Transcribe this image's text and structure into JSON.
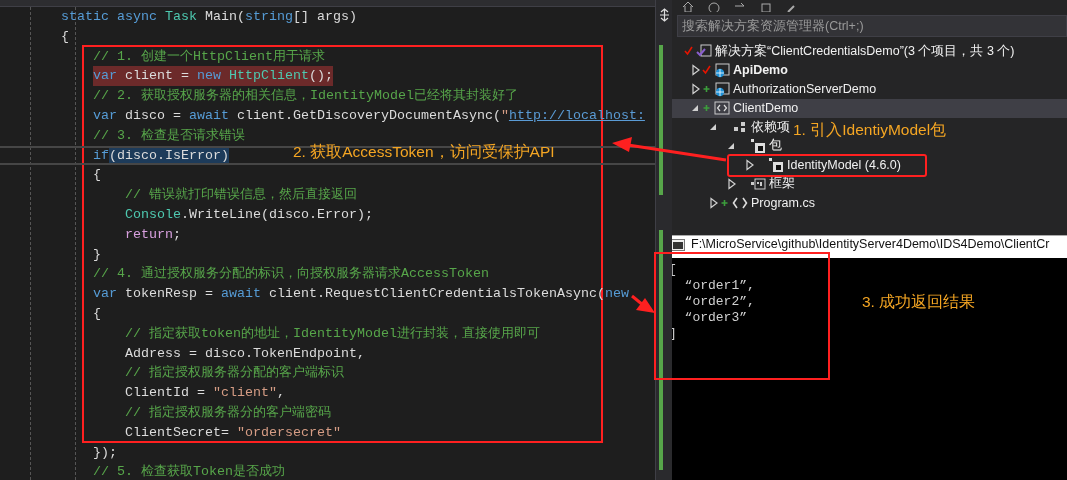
{
  "editor": {
    "lines": [
      {
        "breakpoint": false,
        "current": false,
        "tokens": [
          {
            "kind": "keyword",
            "text": "static"
          },
          {
            "kind": "keyword",
            "text": " async"
          },
          {
            "kind": "type",
            "text": " Task"
          },
          {
            "kind": "plain",
            "text": " Main("
          },
          {
            "kind": "keyword",
            "text": "string"
          },
          {
            "kind": "plain",
            "text": "[] args)"
          }
        ]
      },
      {
        "breakpoint": false,
        "current": false,
        "tokens": [
          {
            "kind": "plain",
            "text": "{"
          }
        ]
      },
      {
        "breakpoint": false,
        "current": false,
        "tokens": [
          {
            "kind": "comment",
            "text": "    // 1. 创建一个HttpClient用于请求"
          }
        ]
      },
      {
        "breakpoint": true,
        "current": false,
        "tokens": [
          {
            "kind": "keyword",
            "text": "    var"
          },
          {
            "kind": "plain",
            "text": " client = "
          },
          {
            "kind": "keyword",
            "text": "new"
          },
          {
            "kind": "type",
            "text": " HttpClient"
          },
          {
            "kind": "plain",
            "text": "();"
          }
        ]
      },
      {
        "breakpoint": false,
        "current": false,
        "tokens": [
          {
            "kind": "comment",
            "text": "    // 2. 获取授权服务器的相关信息，IdentityModel已经将其封装好了"
          }
        ]
      },
      {
        "breakpoint": false,
        "current": false,
        "tokens": [
          {
            "kind": "keyword",
            "text": "    var"
          },
          {
            "kind": "plain",
            "text": " disco = "
          },
          {
            "kind": "keyword",
            "text": "await"
          },
          {
            "kind": "plain",
            "text": " client.GetDiscoveryDocumentAsync("
          },
          {
            "kind": "string",
            "text": "\""
          },
          {
            "kind": "link",
            "text": "http://localhost:"
          }
        ]
      },
      {
        "breakpoint": false,
        "current": false,
        "tokens": [
          {
            "kind": "comment",
            "text": "    // 3. 检查是否请求错误"
          }
        ]
      },
      {
        "breakpoint": false,
        "current": true,
        "tokens": [
          {
            "kind": "keyword",
            "text": "    if"
          },
          {
            "kind": "match",
            "text": "(disco.IsError)"
          }
        ]
      },
      {
        "breakpoint": false,
        "current": false,
        "tokens": [
          {
            "kind": "plain",
            "text": "    {"
          }
        ]
      },
      {
        "breakpoint": false,
        "current": false,
        "tokens": [
          {
            "kind": "comment",
            "text": "        // 错误就打印错误信息，然后直接返回"
          }
        ]
      },
      {
        "breakpoint": false,
        "current": false,
        "tokens": [
          {
            "kind": "type",
            "text": "        Console"
          },
          {
            "kind": "plain",
            "text": ".WriteLine(disco.Error);"
          }
        ]
      },
      {
        "breakpoint": false,
        "current": false,
        "tokens": [
          {
            "kind": "control",
            "text": "        return"
          },
          {
            "kind": "plain",
            "text": ";"
          }
        ]
      },
      {
        "breakpoint": false,
        "current": false,
        "tokens": [
          {
            "kind": "plain",
            "text": "    }"
          }
        ]
      },
      {
        "breakpoint": false,
        "current": false,
        "tokens": [
          {
            "kind": "comment",
            "text": "    // 4. 通过授权服务分配的标识，向授权服务器请求AccessToken"
          }
        ]
      },
      {
        "breakpoint": false,
        "current": false,
        "tokens": [
          {
            "kind": "keyword",
            "text": "    var"
          },
          {
            "kind": "plain",
            "text": " tokenResp = "
          },
          {
            "kind": "keyword",
            "text": "await"
          },
          {
            "kind": "plain",
            "text": " client.RequestClientCredentialsTokenAsync("
          },
          {
            "kind": "keyword",
            "text": "new"
          }
        ]
      },
      {
        "breakpoint": false,
        "current": false,
        "tokens": [
          {
            "kind": "plain",
            "text": "    {"
          }
        ]
      },
      {
        "breakpoint": false,
        "current": false,
        "tokens": [
          {
            "kind": "comment",
            "text": "        // 指定获取token的地址，IdentityModel进行封装，直接使用即可"
          }
        ]
      },
      {
        "breakpoint": false,
        "current": false,
        "tokens": [
          {
            "kind": "plain",
            "text": "        Address = disco.TokenEndpoint,"
          }
        ]
      },
      {
        "breakpoint": false,
        "current": false,
        "tokens": [
          {
            "kind": "comment",
            "text": "        // 指定授权服务器分配的客户端标识"
          }
        ]
      },
      {
        "breakpoint": false,
        "current": false,
        "tokens": [
          {
            "kind": "plain",
            "text": "        ClientId = "
          },
          {
            "kind": "string",
            "text": "\"client\""
          },
          {
            "kind": "plain",
            "text": ","
          }
        ]
      },
      {
        "breakpoint": false,
        "current": false,
        "tokens": [
          {
            "kind": "comment",
            "text": "        // 指定授权服务器分的客户端密码"
          }
        ]
      },
      {
        "breakpoint": false,
        "current": false,
        "tokens": [
          {
            "kind": "plain",
            "text": "        ClientSecret= "
          },
          {
            "kind": "string",
            "text": "\"ordersecret\""
          }
        ]
      },
      {
        "breakpoint": false,
        "current": false,
        "tokens": [
          {
            "kind": "plain",
            "text": "    });"
          }
        ]
      },
      {
        "breakpoint": false,
        "current": false,
        "tokens": [
          {
            "kind": "comment",
            "text": "    // 5. 检查获取Token是否成功"
          }
        ]
      }
    ]
  },
  "solution_explorer": {
    "search": {
      "placeholder": "搜索解决方案资源管理器(Ctrl+;)"
    },
    "solution": {
      "kind": "solution",
      "label": "解决方案“ClientCredentialsDemo”(3 个项目，共 3 个)",
      "checked_in": true,
      "children": [
        {
          "kind": "web",
          "label": "ApiDemo",
          "checked_in": true,
          "bold": true,
          "selected": false,
          "expanded": false
        },
        {
          "kind": "web",
          "label": "AuthorizationServerDemo",
          "checked_in": false,
          "added": true,
          "bold": false,
          "selected": false,
          "expanded": false
        },
        {
          "kind": "project",
          "label": "ClientDemo",
          "checked_in": false,
          "added": true,
          "bold": false,
          "selected": true,
          "expanded": true,
          "children": [
            {
              "kind": "dependencies",
              "label": "依赖项",
              "checked_in": false,
              "added": false,
              "bold": false,
              "selected": false,
              "expanded": true,
              "children": [
                {
                  "kind": "package",
                  "label": "包",
                  "checked_in": false,
                  "added": false,
                  "bold": false,
                  "selected": false,
                  "expanded": true,
                  "children": [
                    {
                      "kind": "package",
                      "label": "IdentityModel (4.6.0)",
                      "checked_in": false,
                      "added": false,
                      "bold": false,
                      "selected": false,
                      "expanded": false
                    }
                  ]
                },
                {
                  "kind": "framework",
                  "label": "框架",
                  "checked_in": false,
                  "added": false,
                  "bold": false,
                  "selected": false,
                  "expanded": false
                }
              ]
            },
            {
              "kind": "file",
              "label": "Program.cs",
              "checked_in": false,
              "added": true,
              "bold": false,
              "selected": false,
              "expanded": false
            }
          ]
        }
      ]
    }
  },
  "console": {
    "title": "F:\\MicroService\\github\\IdentityServer4Demo\\IDS4Demo\\ClientCr",
    "lines": [
      "[",
      "  “order1”,",
      "  “order2”,",
      "  “order3”",
      "]"
    ]
  },
  "annotations": [
    {
      "text": "1. 引入IdentiyModel包"
    },
    {
      "text": "2. 获取AccessToken，访问受保护API"
    },
    {
      "text": "3. 成功返回结果"
    }
  ]
}
